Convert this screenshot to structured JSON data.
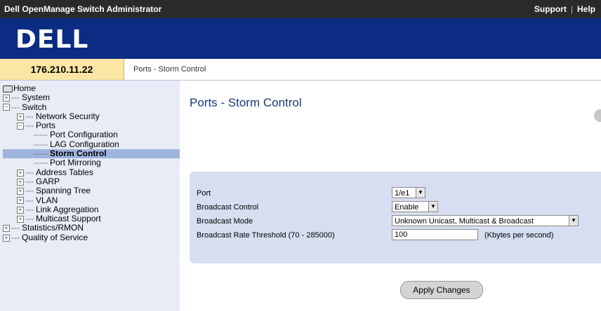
{
  "header": {
    "app_title": "Dell OpenManage Switch Administrator",
    "support": "Support",
    "help": "Help"
  },
  "logo": "DELL",
  "ip": "176.210.11.22",
  "breadcrumb": "Ports - Storm Control",
  "tree": [
    {
      "label": "Home",
      "icon": "home-icon"
    },
    {
      "label": "System"
    },
    {
      "label": "Switch"
    },
    {
      "label": "Network Security"
    },
    {
      "label": "Ports"
    },
    {
      "label": "Port Configuration"
    },
    {
      "label": "LAG Configuration"
    },
    {
      "label": "Storm Control",
      "selected": true
    },
    {
      "label": "Port Mirroring"
    },
    {
      "label": "Address Tables"
    },
    {
      "label": "GARP"
    },
    {
      "label": "Spanning Tree"
    },
    {
      "label": "VLAN"
    },
    {
      "label": "Link Aggregation"
    },
    {
      "label": "Multicast Support"
    },
    {
      "label": "Statistics/RMON"
    },
    {
      "label": "Quality of Service"
    }
  ],
  "main": {
    "title": "Ports - Storm Control",
    "fields": {
      "port_label": "Port",
      "port_value": "1/e1",
      "broadcast_control_label": "Broadcast Control",
      "broadcast_control_value": "Enable",
      "broadcast_mode_label": "Broadcast Mode",
      "broadcast_mode_value": "Unknown Unicast, Multicast & Broadcast",
      "threshold_label": "Broadcast Rate Threshold (70 - 285000)",
      "threshold_value": "100",
      "threshold_unit": "(Kbytes per second)"
    },
    "apply_label": "Apply Changes"
  }
}
